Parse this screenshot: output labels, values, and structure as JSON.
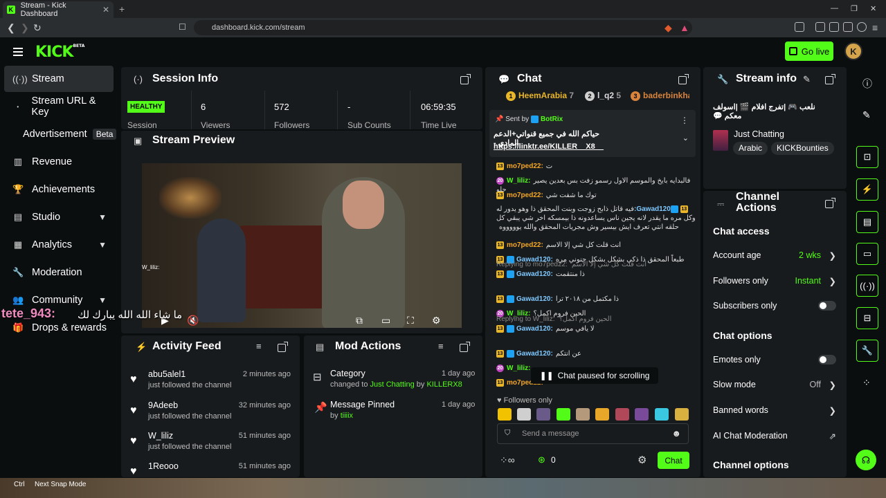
{
  "browser": {
    "tab_title": "Stream - Kick Dashboard",
    "tab_close": "✕",
    "new_tab": "+",
    "url": "dashboard.kick.com/stream",
    "window_controls": [
      "—",
      "❐",
      "✕"
    ]
  },
  "header": {
    "logo": "KICK",
    "logo_badge": "BETA",
    "go_live": "Go live",
    "avatar_letter": "K"
  },
  "sidebar": {
    "items": [
      {
        "label": "Stream",
        "icon": "broadcast-icon"
      },
      {
        "label": "Stream URL & Key",
        "icon": "dot-icon"
      },
      {
        "label": "Advertisement",
        "badge": "Beta"
      },
      {
        "label": "Revenue",
        "icon": "chart-icon"
      },
      {
        "label": "Achievements",
        "icon": "trophy-icon"
      },
      {
        "label": "Studio",
        "icon": "film-icon"
      },
      {
        "label": "Analytics",
        "icon": "analytics-icon"
      },
      {
        "label": "Moderation",
        "icon": "wrench-icon"
      },
      {
        "label": "Community",
        "icon": "people-icon"
      },
      {
        "label": "Drops & rewards",
        "icon": "gift-icon"
      }
    ]
  },
  "session": {
    "title": "Session Info",
    "status": "HEALTHY",
    "status_label": "Session",
    "stats": [
      {
        "value": "6",
        "label": "Viewers"
      },
      {
        "value": "572",
        "label": "Followers"
      },
      {
        "value": "-",
        "label": "Sub Counts"
      },
      {
        "value": "06:59:35",
        "label": "Time Live"
      }
    ]
  },
  "preview": {
    "title": "Stream Preview",
    "overlay_user": "tete_943:",
    "overlay_msg": "ما شاء الله الله يبارك لك",
    "small_overlay": "W_liliz:"
  },
  "activity": {
    "title": "Activity Feed",
    "items": [
      {
        "name": "abu5alel1",
        "text": "just followed the channel",
        "time": "2 minutes ago"
      },
      {
        "name": "9Adeeb",
        "text": "just followed the channel",
        "time": "32 minutes ago"
      },
      {
        "name": "W_liliz",
        "text": "just followed the channel",
        "time": "51 minutes ago"
      },
      {
        "name": "1Reooo",
        "text": "",
        "time": "51 minutes ago"
      }
    ]
  },
  "mod": {
    "title": "Mod Actions",
    "items": [
      {
        "title": "Category",
        "pre": "changed to ",
        "hl1": "Just Chatting",
        "mid": " by ",
        "hl2": "KILLERX8",
        "time": "1 day ago"
      },
      {
        "title": "Message Pinned",
        "pre": "by ",
        "hl1": "tiiiix",
        "mid": "",
        "hl2": "",
        "time": "1 day ago"
      }
    ]
  },
  "chat": {
    "title": "Chat",
    "top": [
      {
        "rank": "1",
        "name": "HeemArabia",
        "count": "7",
        "color": "#e9b629"
      },
      {
        "rank": "2",
        "name": "l_q2",
        "count": "5",
        "color": "#cfcfcf"
      },
      {
        "rank": "3",
        "name": "baderbinkha",
        "count": "",
        "color": "#d9843c"
      }
    ],
    "pinned_by_label": "Sent by",
    "pinned_by": "BotRix",
    "pinned_msg": "حياكم الله في جميع قنواتي+الدعم المادي -",
    "pinned_link": "https://linktr.ee/KILLER__X8__",
    "messages": [
      {
        "badge": "13",
        "user": "mo7ped22:",
        "text": "ت",
        "cls": "u-o"
      },
      {
        "badge": "20",
        "user": "W_liliz:",
        "text": "فالبدايه بايخ والموسم الاول رسمو زفت بس بعدين يصير حلو",
        "cls": "u-g"
      },
      {
        "badge": "13",
        "user": "mo7ped22:",
        "text": "توك ما شفت شي",
        "cls": "u-o"
      },
      {
        "badge": "13",
        "user": "Gawad120:",
        "text": "فيه قاتل ذابح زوجت وبنت المحقق ذا وهو يدور له وكل مره ما يقدر لانه يجين ناس يساعدونه ذا بيمسكه اخر شي يبقي كل حلقه انتي تعرف ايش بيسير وش مجريات المحقق والله يوووووه",
        "cls": "u-b"
      },
      {
        "badge": "13",
        "user": "mo7ped22:",
        "text": "انت قلت كل شي إلا الاسم",
        "cls": "u-o"
      },
      {
        "badge": "13",
        "user": "Gawad120:",
        "text": "طبعاً المحقق ذا ذكي بشكل بشكل جنوني مره",
        "cls": "u-b"
      },
      {
        "reply": "Replying to mo7ped22:",
        "reply_text": "انت قلت كل شي إلا الاسم",
        "badge": "13",
        "user": "Gawad120:",
        "text": "ذا منتقمت",
        "cls": "u-b"
      },
      {
        "badge": "13",
        "user": "Gawad120:",
        "text": "ذا مكتمل من ٢٠١٨ ترا",
        "cls": "u-b"
      },
      {
        "badge": "20",
        "user": "W_liliz:",
        "text": "الحين فروم اكمل؟",
        "cls": "u-g"
      },
      {
        "reply": "Replying to W_liliz:",
        "reply_text": "الحين فروم اكمل؟",
        "badge": "13",
        "user": "Gawad120:",
        "text": "لا يافي موسم",
        "cls": "u-b"
      },
      {
        "badge": "13",
        "user": "Gawad120:",
        "text": "عن انتكم",
        "cls": "u-b"
      },
      {
        "badge": "20",
        "user": "W_liliz:",
        "text": "",
        "cls": "u-g"
      },
      {
        "badge": "13",
        "user": "mo7ped22:",
        "text": "",
        "cls": "u-o"
      }
    ],
    "paused": "Chat paused for scrolling",
    "followers_only": "Followers only",
    "placeholder": "Send a message",
    "points": "0",
    "send": "Chat"
  },
  "stream_info": {
    "title": "Stream info",
    "stream_title": "نلعب 🎮 |تفرج افلام 🎬 |اسولف معكم 💬",
    "category": "Just Chatting",
    "tags": [
      "Arabic",
      "KICKBounties"
    ]
  },
  "channel": {
    "title_line1": "Channel",
    "title_line2": "Actions",
    "chat_access": "Chat access",
    "rows": [
      {
        "label": "Account age",
        "value": "2 wks",
        "kind": "arrow",
        "green": true
      },
      {
        "label": "Followers only",
        "value": "Instant",
        "kind": "arrow",
        "green": true
      },
      {
        "label": "Subscribers only",
        "value": "",
        "kind": "toggle"
      }
    ],
    "chat_options": "Chat options",
    "rows2": [
      {
        "label": "Emotes only",
        "value": "",
        "kind": "toggle"
      },
      {
        "label": "Slow mode",
        "value": "Off",
        "kind": "arrow",
        "green": false
      },
      {
        "label": "Banned words",
        "value": "",
        "kind": "arrow"
      },
      {
        "label": "AI Chat Moderation",
        "value": "",
        "kind": "ext"
      }
    ],
    "channel_options": "Channel options"
  },
  "taskbar": {
    "left": "Ctrl",
    "mid": "Next Snap Mode"
  },
  "colors": {
    "accent": "#53fc18",
    "panel": "#181b1d",
    "bg": "#0b0e0f"
  }
}
